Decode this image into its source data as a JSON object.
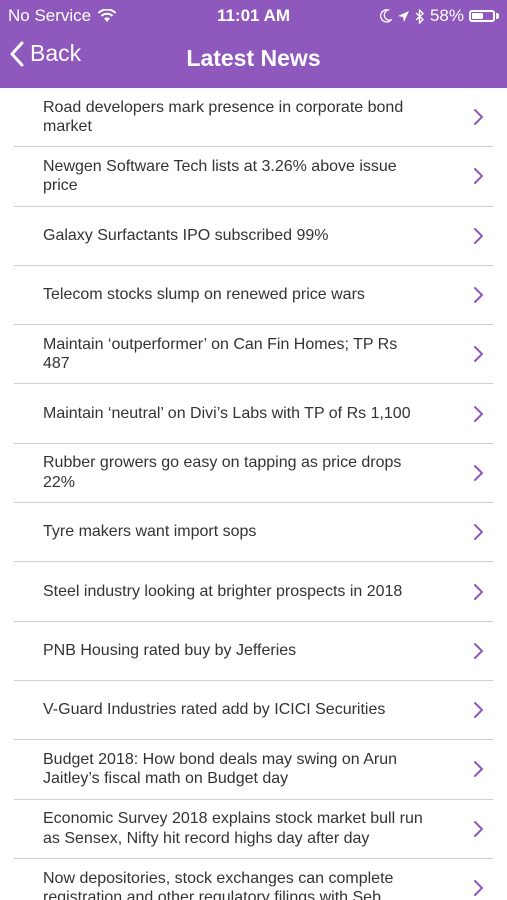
{
  "status_bar": {
    "carrier": "No Service",
    "time": "11:01 AM",
    "battery": "58%",
    "battery_level": 0.58
  },
  "nav": {
    "back_label": "Back",
    "title": "Latest News"
  },
  "colors": {
    "header_bg": "#8e58bd",
    "chevron": "#8e58bd"
  },
  "news": [
    {
      "title": "Road developers mark presence in corporate bond market"
    },
    {
      "title": "Newgen Software Tech lists at 3.26% above issue price"
    },
    {
      "title": "Galaxy Surfactants IPO subscribed 99%"
    },
    {
      "title": "Telecom stocks slump on renewed price wars"
    },
    {
      "title": "Maintain ‘outperformer’ on Can Fin Homes; TP Rs 487"
    },
    {
      "title": "Maintain ‘neutral’ on Divi’s Labs with TP of Rs 1,100"
    },
    {
      "title": "Rubber growers go easy on tapping as price drops 22%"
    },
    {
      "title": "Tyre makers want import sops"
    },
    {
      "title": "Steel industry looking at brighter prospects in 2018"
    },
    {
      "title": "PNB Housing rated buy by Jefferies"
    },
    {
      "title": "V-Guard Industries rated add by ICICI Securities"
    },
    {
      "title": "Budget 2018: How bond deals may swing on Arun Jaitley’s fiscal math on Budget day"
    },
    {
      "title": "Economic Survey 2018 explains stock market bull run as Sensex, Nifty hit record highs day after day"
    },
    {
      "title": "Now depositories, stock exchanges can complete registration and other regulatory filings with Seb..."
    }
  ]
}
